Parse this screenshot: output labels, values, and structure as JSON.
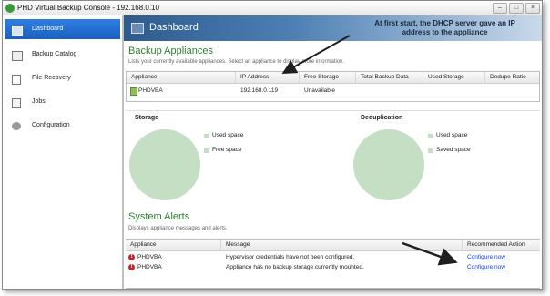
{
  "window": {
    "title": "PHD Virtual Backup Console - 192.168.0.10"
  },
  "sidebar": {
    "items": [
      {
        "label": "Dashboard",
        "icon": "dashboard-icon",
        "active": true
      },
      {
        "label": "Backup Catalog",
        "icon": "catalog-icon"
      },
      {
        "label": "File Recovery",
        "icon": "file-icon"
      },
      {
        "label": "Jobs",
        "icon": "jobs-icon"
      },
      {
        "label": "Configuration",
        "icon": "gear-icon"
      }
    ]
  },
  "banner": {
    "title": "Dashboard"
  },
  "annotation": {
    "text": "At first start, the DHCP server gave an IP address to the appliance"
  },
  "appliances": {
    "title": "Backup Appliances",
    "subtitle": "Lists your currently available appliances. Select an appliance to display more information.",
    "columns": [
      "Appliance",
      "IP Address",
      "Free Storage",
      "Total Backup Data",
      "Used Storage",
      "Dedupe Ratio"
    ],
    "rows": [
      {
        "appliance": "PHDVBA",
        "ip": "192.168.0.119",
        "free": "Unavailable"
      }
    ]
  },
  "storage": {
    "title": "Storage",
    "legend": [
      "Used space",
      "Free space"
    ]
  },
  "dedup": {
    "title": "Deduplication",
    "legend": [
      "Used space",
      "Saved space"
    ]
  },
  "alerts": {
    "title": "System Alerts",
    "subtitle": "Displays appliance messages and alerts.",
    "columns": [
      "Appliance",
      "Message",
      "Recommended Action"
    ],
    "rows": [
      {
        "appliance": "PHDVBA",
        "message": "Hypervisor credentials have not been configured.",
        "action": "Configure now"
      },
      {
        "appliance": "PHDVBA",
        "message": "Appliance has no backup storage currently mounted.",
        "action": "Configure now"
      }
    ]
  },
  "colors": {
    "accent": "#1b5fc2",
    "section": "#2e7d32",
    "chart": "#c5dfc4",
    "error": "#c62828"
  }
}
